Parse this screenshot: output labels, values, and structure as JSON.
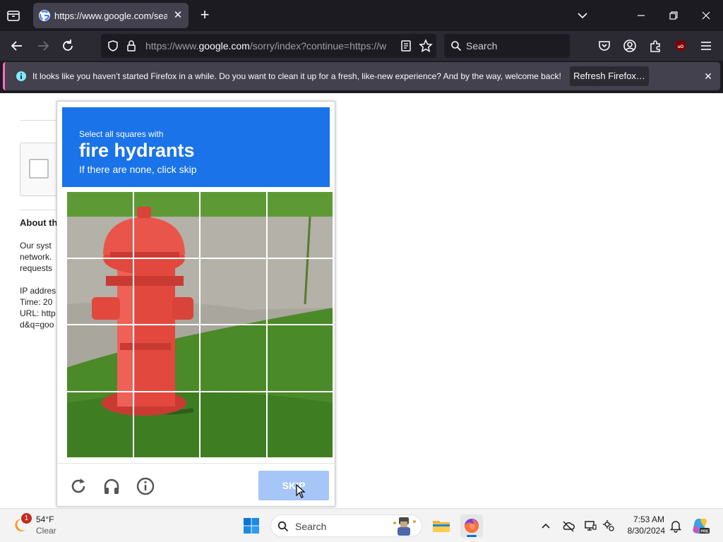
{
  "browser": {
    "tab": {
      "title": "https://www.google.com/sear"
    },
    "url": {
      "prefix": "https://www.",
      "domain": "google.com",
      "suffix": "/sorry/index?continue=https://w"
    },
    "search_placeholder": "Search"
  },
  "notification": {
    "message": "It looks like you haven’t started Firefox in a while. Do you want to clean it up for a fresh, like-new experience? And by the way, welcome back!",
    "button_label": "Refresh Firefox…"
  },
  "page": {
    "about_heading": "About th",
    "lines": [
      "Our syst",
      "network.",
      "requests",
      "",
      "IP addres",
      "Time: 20",
      "URL: http",
      "d&q=goo"
    ]
  },
  "challenge": {
    "instruction_small": "Select all squares with",
    "target": "fire hydrants",
    "hint": "If there are none, click skip",
    "skip_label": "SKIP"
  },
  "taskbar": {
    "weather": {
      "temp": "54°F",
      "condition": "Clear",
      "badge": "1"
    },
    "search_placeholder": "Search",
    "clock": {
      "time": "7:53 AM",
      "date": "8/30/2024"
    }
  },
  "colors": {
    "challenge_header": "#1a73e8",
    "skip_button": "#a5c6f7",
    "browser_dark": "#1c1b22",
    "notification_accent": "#ff6bba"
  }
}
